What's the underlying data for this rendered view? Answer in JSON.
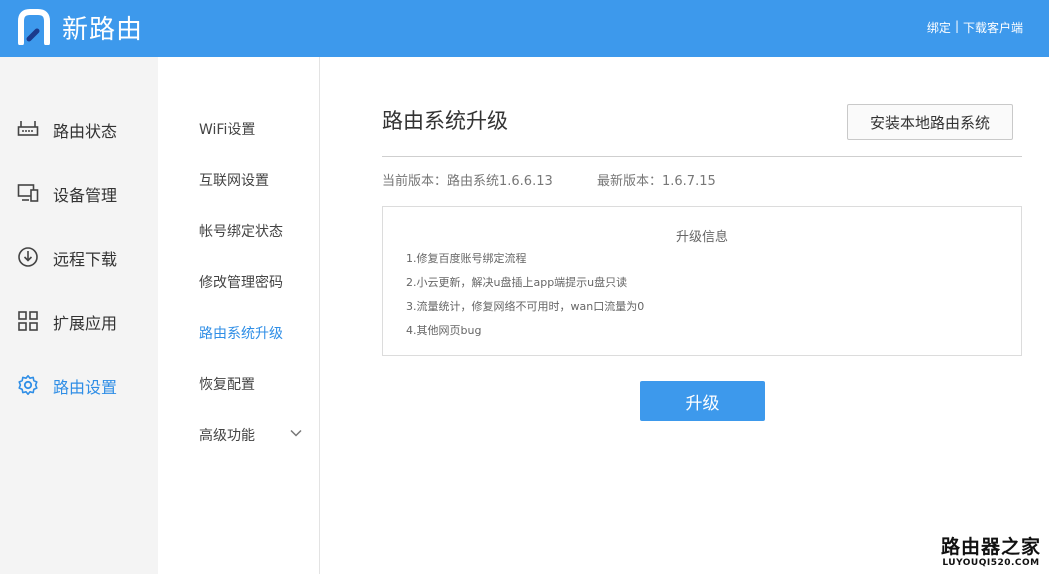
{
  "header": {
    "logo_text": "新路由",
    "link_bind": "绑定",
    "link_separator": "|",
    "link_download": "下载客户端"
  },
  "sidebar": {
    "items": [
      {
        "label": "路由状态",
        "icon": "router-icon"
      },
      {
        "label": "设备管理",
        "icon": "monitor-devices-icon"
      },
      {
        "label": "远程下载",
        "icon": "download-icon"
      },
      {
        "label": "扩展应用",
        "icon": "grid-apps-icon"
      },
      {
        "label": "路由设置",
        "icon": "gear-icon"
      }
    ],
    "active_index": 4
  },
  "submenu": {
    "items": [
      {
        "label": "WiFi设置"
      },
      {
        "label": "互联网设置"
      },
      {
        "label": "帐号绑定状态"
      },
      {
        "label": "修改管理密码"
      },
      {
        "label": "路由系统升级"
      },
      {
        "label": "恢复配置"
      },
      {
        "label": "高级功能"
      }
    ],
    "active_index": 4
  },
  "main": {
    "title": "路由系统升级",
    "install_button": "安装本地路由系统",
    "current_version": "当前版本：路由系统1.6.6.13",
    "latest_version": "最新版本：1.6.7.15",
    "info": {
      "title": "升级信息",
      "lines": [
        "1.修复百度账号绑定流程",
        "2.小云更新，解决u盘插上app端提示u盘只读",
        "3.流量统计，修复网络不可用时，wan口流量为0",
        "4.其他网页bug"
      ]
    },
    "upgrade_button": "升级"
  },
  "watermark": {
    "text": "路由器之家",
    "url": "LUYOUQI520.COM"
  },
  "colors": {
    "brand": "#3d99ec",
    "active": "#2f8ee6",
    "sidebar_bg": "#f4f4f4"
  }
}
